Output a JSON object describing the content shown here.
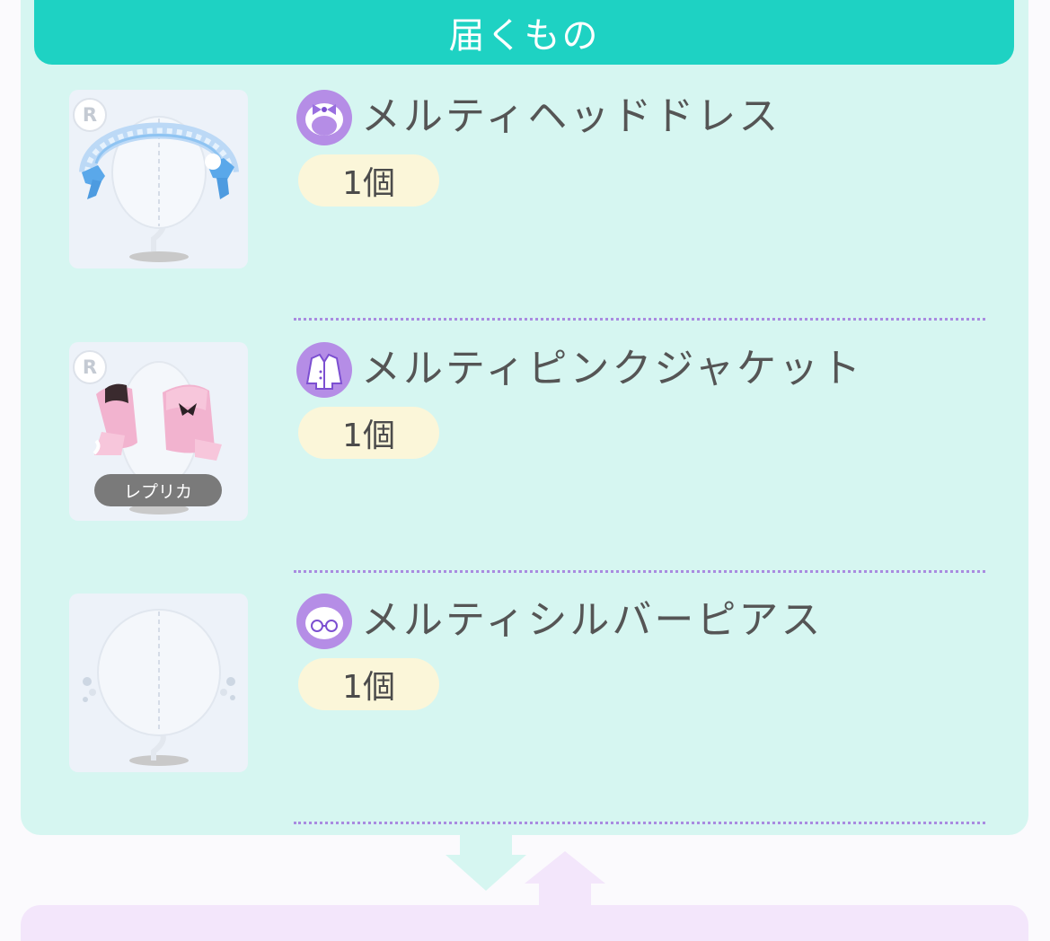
{
  "header": {
    "title": "届くもの"
  },
  "items": [
    {
      "name": "メルティヘッドドレス",
      "quantity": "1個",
      "rarity": "R",
      "category_icon": "headdress-bow-icon",
      "has_replica": false
    },
    {
      "name": "メルティピンクジャケット",
      "quantity": "1個",
      "rarity": "R",
      "category_icon": "jacket-icon",
      "has_replica": true,
      "replica_label": "レプリカ"
    },
    {
      "name": "メルティシルバーピアス",
      "quantity": "1個",
      "rarity": "",
      "category_icon": "glasses-accessory-icon",
      "has_replica": false
    }
  ],
  "colors": {
    "accent": "#1ed2c3",
    "panel": "#d6f6f1",
    "category": "#b58de6",
    "quantity_pill": "#fbf6d9",
    "divider": "#a98be0"
  }
}
